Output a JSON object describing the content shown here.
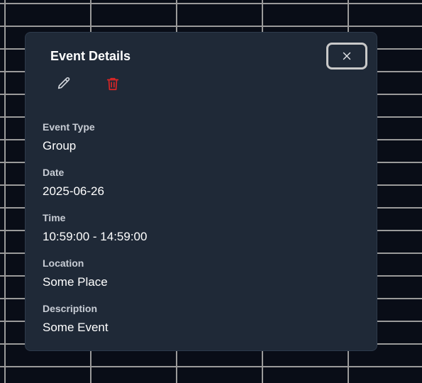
{
  "modal": {
    "title": "Event Details",
    "close_icon": "x-icon",
    "edit_icon": "pencil-icon",
    "delete_icon": "trash-icon",
    "delete_color": "#dc2626",
    "fields": [
      {
        "label": "Event Type",
        "value": "Group"
      },
      {
        "label": "Date",
        "value": "2025-06-26"
      },
      {
        "label": "Time",
        "value": "10:59:00 - 14:59:00"
      },
      {
        "label": "Location",
        "value": "Some Place"
      },
      {
        "label": "Description",
        "value": "Some Event"
      }
    ]
  }
}
